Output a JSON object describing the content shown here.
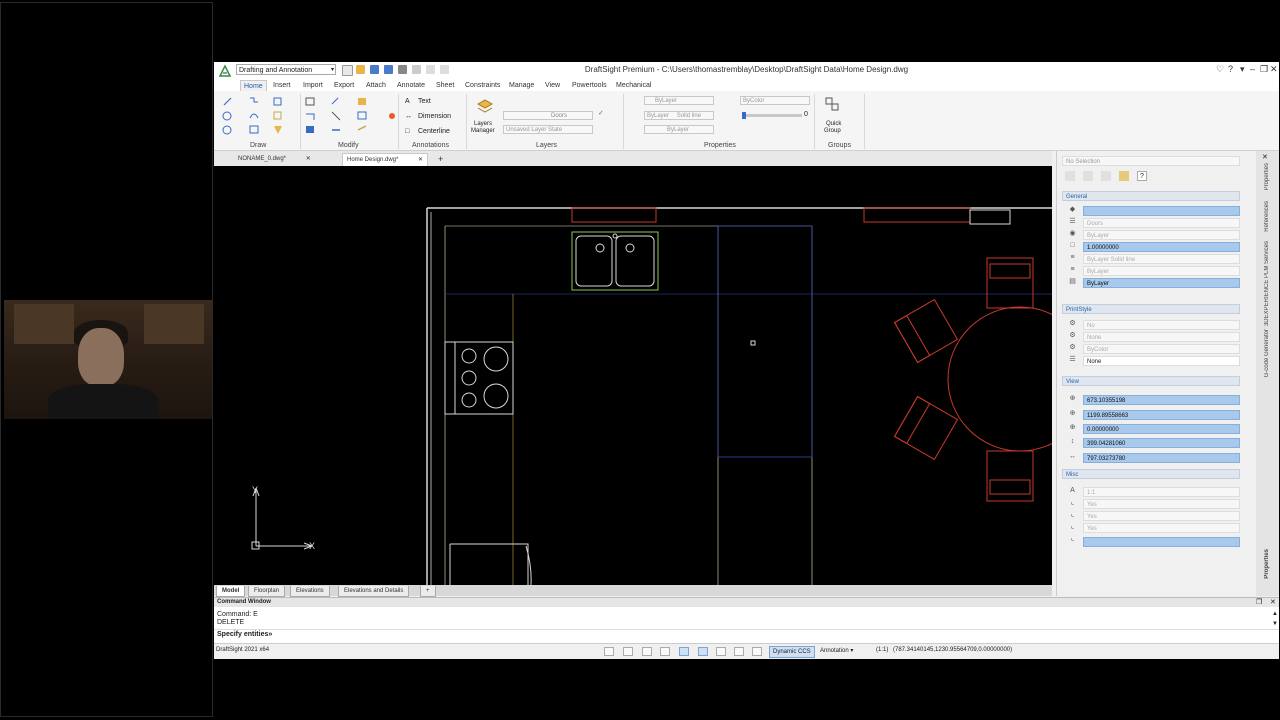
{
  "app": {
    "window_title": "DraftSight Premium - C:\\Users\\thomastremblay\\Desktop\\DraftSight Data\\Home Design.dwg",
    "workspace": "Drafting and Annotation"
  },
  "ribbon": {
    "tabs": [
      "Home",
      "Insert",
      "Import",
      "Export",
      "Attach",
      "Annotate",
      "Sheet",
      "Constraints",
      "Manage",
      "View",
      "Powertools",
      "Mechanical"
    ],
    "groups": {
      "draw": "Draw",
      "modify": "Modify",
      "annotations": "Annotations",
      "layers": "Layers",
      "properties": "Properties",
      "groups": "Groups"
    },
    "annotations": {
      "text": "Text",
      "dimension": "Dimension",
      "centerline": "Centerline"
    },
    "layers": {
      "manager_line1": "Layers",
      "manager_line2": "Manager",
      "current_layer": "Doors",
      "layer_state": "Unsaved Layer State"
    },
    "properties": {
      "color": "ByLayer",
      "color2": "ByColor",
      "linestyle": "ByLayer",
      "linestyle_name": "Solid line",
      "lineweight": "ByLayer",
      "transparency": "0"
    },
    "groups_panel": {
      "quick_group_line1": "Quick",
      "quick_group_line2": "Group"
    }
  },
  "doc_tabs": [
    "NONAME_0.dwg*",
    "Home Design.dwg*"
  ],
  "layout_tabs": [
    "Model",
    "Floorplan",
    "Elevations",
    "Elevations and Details"
  ],
  "properties_panel": {
    "selection": "No Selection",
    "general": {
      "title": "General",
      "layer": "Doors",
      "color": "ByLayer",
      "scale": "1.00000000",
      "linestyle": "ByLayer   Solid line",
      "lineweight": "ByLayer",
      "transparency": "ByLayer"
    },
    "printstyle": {
      "title": "PrintStyle",
      "row1": "No",
      "row2": "None",
      "row3": "ByColor",
      "row4": "None"
    },
    "view": {
      "title": "View",
      "center_x": "673.10355198",
      "center_y": "1199.89558663",
      "center_z": "0.00000000",
      "height": "399.04281060",
      "width": "797.03273780"
    },
    "misc": {
      "title": "Misc",
      "annotative_scale": "1:1",
      "row2": "Yes",
      "row3": "Yes",
      "row4": "Yes"
    }
  },
  "side_tabs": [
    "Properties",
    "References",
    "3DEXPERIENCE PLM Services",
    "G-code Generator",
    "Properties"
  ],
  "command_window": {
    "title": "Command Window",
    "line1": "Command: E",
    "line2": "DELETE",
    "prompt": "Specify entities»"
  },
  "status": {
    "version": "DraftSight 2021 x64",
    "dynamic_ccs": "Dynamic CCS",
    "annotation": "Annotation",
    "scale": "(1:1)",
    "coords": "(787.34140145,1230.95564709,0.00000000)"
  },
  "canvas": {
    "axis_y": "Y",
    "axis_x": "X"
  },
  "colors": {
    "accent": "#1a5fa8",
    "selection": "#a9c9ec",
    "kitchen_lines": "#e8e8c8",
    "cabinet_lines": "#c8a84a",
    "table_lines": "#c83a2a",
    "counter_lines": "#3a4aa8"
  }
}
